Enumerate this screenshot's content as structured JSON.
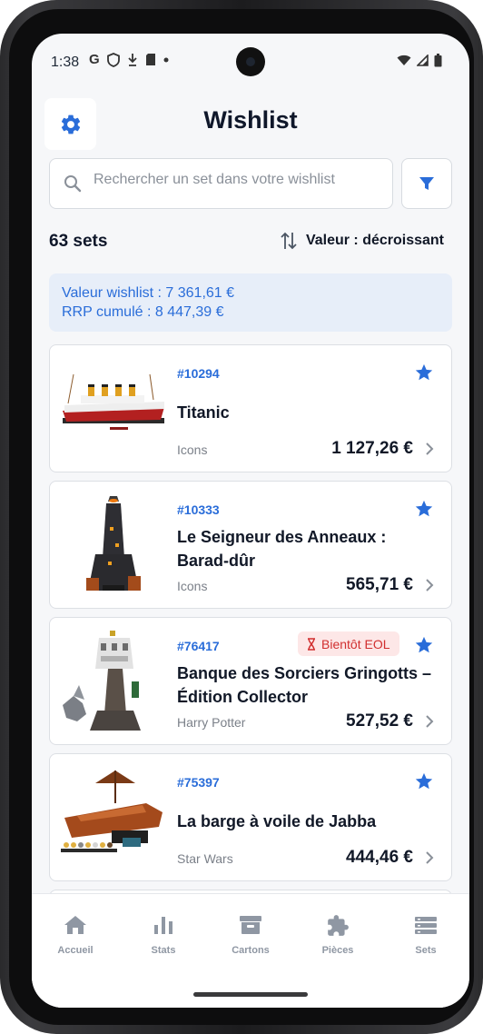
{
  "status_bar": {
    "time": "1:38",
    "left_icons": [
      "google-g-icon",
      "shield-icon",
      "download-icon",
      "sd-card-icon",
      "dot-icon"
    ],
    "right_icons": [
      "wifi-icon",
      "signal-icon",
      "battery-icon"
    ]
  },
  "header": {
    "title": "Wishlist",
    "settings_icon": "gear-icon"
  },
  "search": {
    "placeholder": "Rechercher un set dans votre wishlist",
    "value": ""
  },
  "filter": {
    "icon": "filter-icon"
  },
  "list_meta": {
    "count": "63 sets",
    "sort_label": "Valeur : décroissant",
    "sort_icon": "sort-arrows-icon"
  },
  "summary": {
    "line1": "Valeur wishlist : 7 361,61 €",
    "line2": "RRP cumulé : 8 447,39 €"
  },
  "items": [
    {
      "number": "#10294",
      "title": "Titanic",
      "theme": "Icons",
      "price": "1 127,26 €",
      "favorite": true,
      "badge": ""
    },
    {
      "number": "#10333",
      "title": "Le Seigneur des Anneaux : Barad-dûr",
      "theme": "Icons",
      "price": "565,71 €",
      "favorite": true,
      "badge": ""
    },
    {
      "number": "#76417",
      "title": "Banque des Sorciers Gringotts – Édition Collector",
      "theme": "Harry Potter",
      "price": "527,52 €",
      "favorite": true,
      "badge": "Bientôt EOL"
    },
    {
      "number": "#75397",
      "title": "La barge à voile de Jabba",
      "theme": "Star Wars",
      "price": "444,46 €",
      "favorite": true,
      "badge": ""
    }
  ],
  "nav": [
    {
      "label": "Accueil",
      "icon": "home-icon"
    },
    {
      "label": "Stats",
      "icon": "bar-chart-icon"
    },
    {
      "label": "Cartons",
      "icon": "archive-box-icon"
    },
    {
      "label": "Pièces",
      "icon": "puzzle-piece-icon"
    },
    {
      "label": "Sets",
      "icon": "list-icon"
    }
  ],
  "colors": {
    "accent": "#2a6dd9",
    "background": "#f6f7f9",
    "eol_text": "#d12f2f",
    "eol_bg": "#fde7e7",
    "muted": "#8f97a3"
  }
}
